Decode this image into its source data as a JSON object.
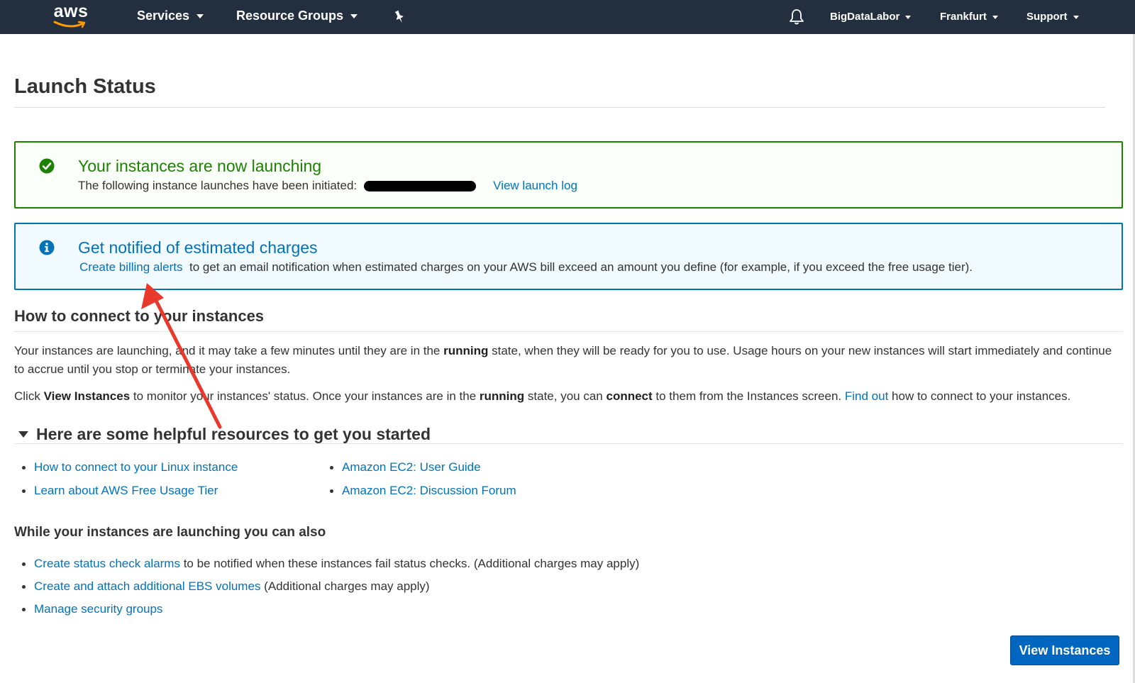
{
  "nav": {
    "logo_text": "aws",
    "services": "Services",
    "resource_groups": "Resource Groups",
    "account": "BigDataLabor",
    "region": "Frankfurt",
    "support": "Support"
  },
  "page": {
    "title": "Launch Status"
  },
  "success_alert": {
    "title": "Your instances are now launching",
    "body": "The following instance launches have been initiated:",
    "link": "View launch log"
  },
  "info_alert": {
    "title": "Get notified of estimated charges",
    "link": "Create billing alerts",
    "body": "to get an email notification when estimated charges on your AWS bill exceed an amount you define (for example, if you exceed the free usage tier)."
  },
  "connect": {
    "heading": "How to connect to your instances",
    "p1_a": "Your instances are launching, and it may take a few minutes until they are in the",
    "p1_b": "running",
    "p1_c": "state, when they will be ready for you to use. Usage hours on your new instances will start immediately and continue to accrue until you stop or terminate your instances.",
    "p2_a": "Click",
    "p2_b": "View Instances",
    "p2_c": "to monitor your instances' status. Once your instances are in the",
    "p2_d": "running",
    "p2_e": "state, you can",
    "p2_f": "connect",
    "p2_g": "to them from the Instances screen.",
    "p2_link": "Find out",
    "p2_h": "how to connect to your instances."
  },
  "resources": {
    "heading": "Here are some helpful resources to get you started",
    "col1": [
      "How to connect to your Linux instance",
      "Learn about AWS Free Usage Tier"
    ],
    "col2": [
      "Amazon EC2: User Guide",
      "Amazon EC2: Discussion Forum"
    ]
  },
  "also": {
    "heading": "While your instances are launching you can also",
    "items": [
      {
        "link": "Create status check alarms",
        "text": "to be notified when these instances fail status checks. (Additional charges may apply)"
      },
      {
        "link": "Create and attach additional EBS volumes",
        "text": "(Additional charges may apply)"
      },
      {
        "link": "Manage security groups",
        "text": ""
      }
    ]
  },
  "buttons": {
    "view_instances": "View Instances"
  },
  "colors": {
    "nav_bg": "#232f3e",
    "success": "#1d8102",
    "info": "#0073bb",
    "link": "#0073bb",
    "primary_button": "#0066c0",
    "annotation": "#e8392c"
  }
}
